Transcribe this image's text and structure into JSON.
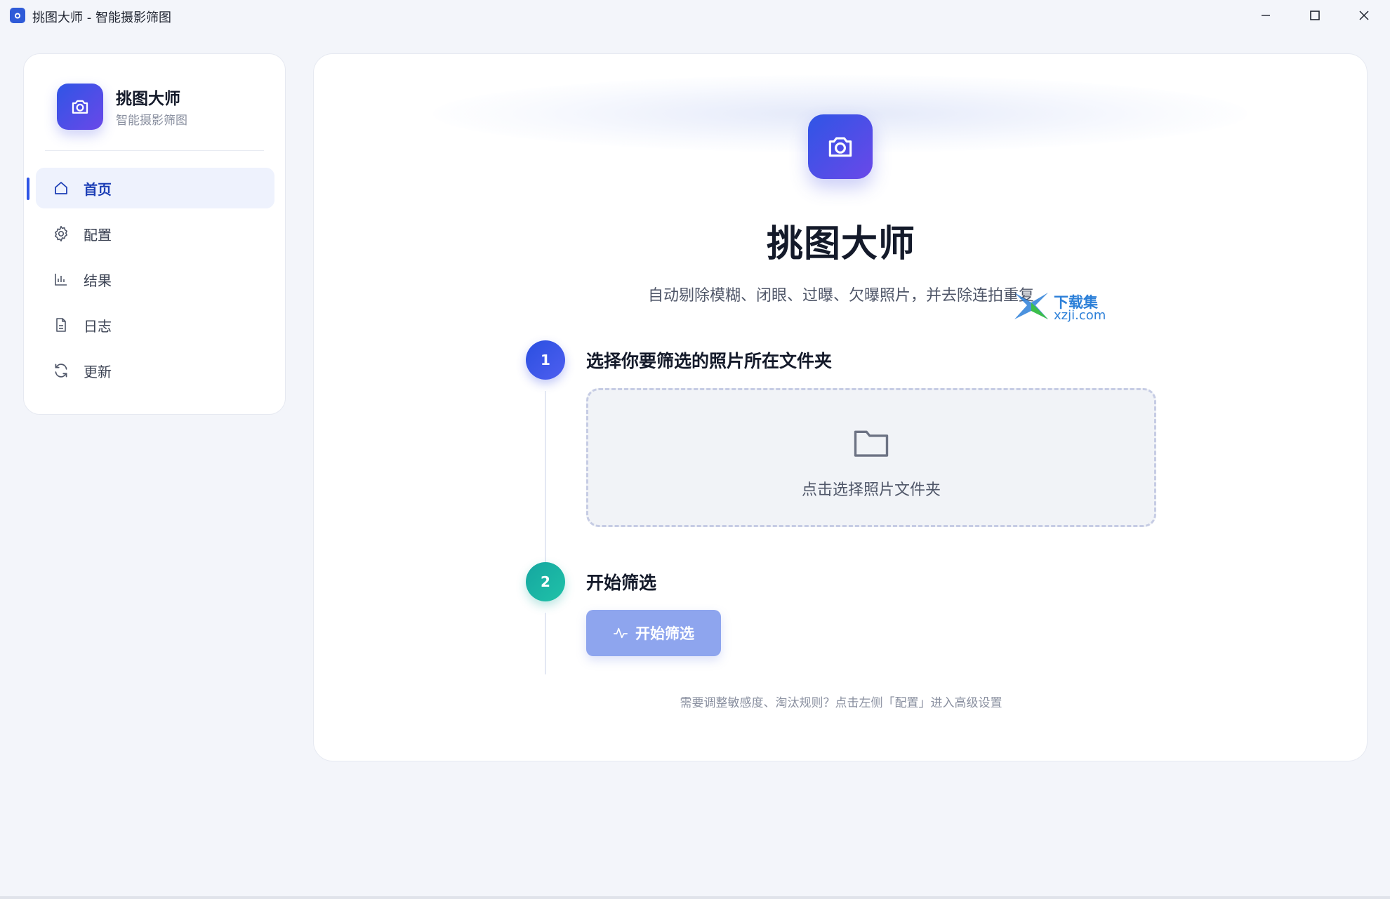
{
  "window": {
    "title": "挑图大师 - 智能摄影筛图",
    "controls": [
      "minimize-icon",
      "maximize-icon",
      "close-icon"
    ]
  },
  "sidebar": {
    "brand_name": "挑图大师",
    "brand_sub": "智能摄影筛图",
    "items": [
      {
        "label": "首页",
        "icon": "home-icon",
        "active": true
      },
      {
        "label": "配置",
        "icon": "gear-icon",
        "active": false
      },
      {
        "label": "结果",
        "icon": "bar-chart-icon",
        "active": false
      },
      {
        "label": "日志",
        "icon": "document-icon",
        "active": false
      },
      {
        "label": "更新",
        "icon": "refresh-icon",
        "active": false
      }
    ]
  },
  "main": {
    "title": "挑图大师",
    "subtitle": "自动剔除模糊、闭眼、过曝、欠曝照片，并去除连拍重复",
    "steps": [
      {
        "number": "1",
        "title": "选择你要筛选的照片所在文件夹"
      },
      {
        "number": "2",
        "title": "开始筛选"
      }
    ],
    "dropzone_text": "点击选择照片文件夹",
    "start_button": "开始筛选",
    "hint": "需要调整敏感度、淘汰规则？点击左侧「配置」进入高级设置"
  },
  "watermark": {
    "line1": "下载集",
    "line2": "xzji.com"
  },
  "colors": {
    "accent": "#2f55e6",
    "accent_end": "#6a48e8",
    "step2": "#15a6a0",
    "button_disabled": "#8ea5ee",
    "background": "#f3f5fa"
  }
}
